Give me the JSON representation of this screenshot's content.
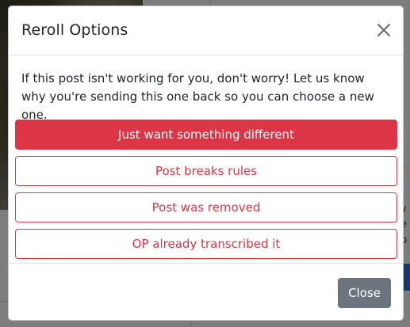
{
  "modal": {
    "title": "Reroll Options",
    "intro": "If this post isn't working for you, don't worry! Let us know why you're sending this one back so you can choose a new one.",
    "options": [
      "Just want something different",
      "Post breaks rules",
      "Post was removed",
      "OP already transcribed it"
    ],
    "close_label": "Close",
    "close_icon": "close-x-icon"
  },
  "background": {
    "snippet_y": "y",
    "snippet_e": "e",
    "snippet_b": "b"
  },
  "colors": {
    "danger": "#dc3545",
    "secondary": "#6c757d",
    "backdrop": "rgba(0,0,0,0.5)"
  }
}
